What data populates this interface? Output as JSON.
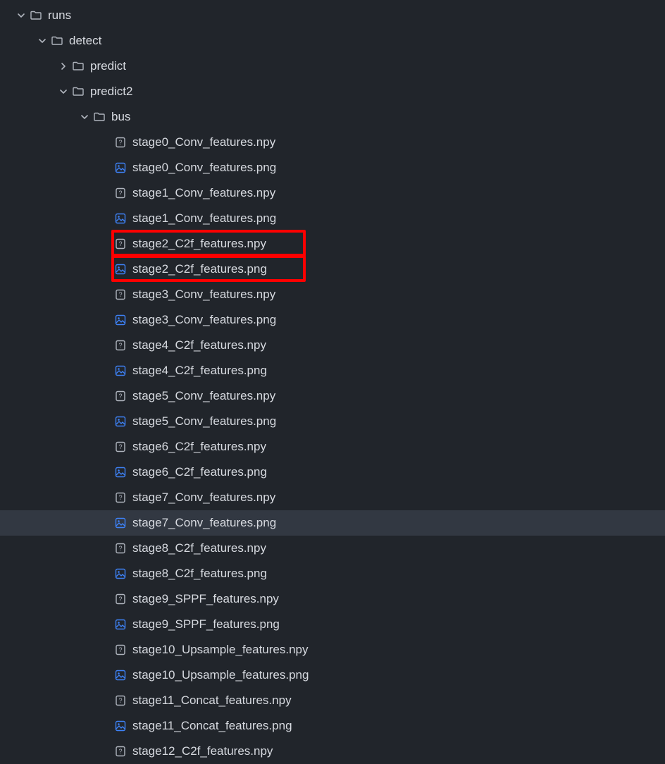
{
  "tree": [
    {
      "indent": 0,
      "type": "folder",
      "expanded": true,
      "label": "runs"
    },
    {
      "indent": 1,
      "type": "folder",
      "expanded": true,
      "label": "detect"
    },
    {
      "indent": 2,
      "type": "folder",
      "expanded": false,
      "label": "predict"
    },
    {
      "indent": 2,
      "type": "folder",
      "expanded": true,
      "label": "predict2"
    },
    {
      "indent": 3,
      "type": "folder",
      "expanded": true,
      "label": "bus"
    },
    {
      "indent": 4,
      "type": "npy",
      "label": "stage0_Conv_features.npy"
    },
    {
      "indent": 4,
      "type": "png",
      "label": "stage0_Conv_features.png"
    },
    {
      "indent": 4,
      "type": "npy",
      "label": "stage1_Conv_features.npy"
    },
    {
      "indent": 4,
      "type": "png",
      "label": "stage1_Conv_features.png"
    },
    {
      "indent": 4,
      "type": "npy",
      "label": "stage2_C2f_features.npy",
      "highlighted": true
    },
    {
      "indent": 4,
      "type": "png",
      "label": "stage2_C2f_features.png",
      "highlighted": true
    },
    {
      "indent": 4,
      "type": "npy",
      "label": "stage3_Conv_features.npy"
    },
    {
      "indent": 4,
      "type": "png",
      "label": "stage3_Conv_features.png"
    },
    {
      "indent": 4,
      "type": "npy",
      "label": "stage4_C2f_features.npy"
    },
    {
      "indent": 4,
      "type": "png",
      "label": "stage4_C2f_features.png"
    },
    {
      "indent": 4,
      "type": "npy",
      "label": "stage5_Conv_features.npy"
    },
    {
      "indent": 4,
      "type": "png",
      "label": "stage5_Conv_features.png"
    },
    {
      "indent": 4,
      "type": "npy",
      "label": "stage6_C2f_features.npy"
    },
    {
      "indent": 4,
      "type": "png",
      "label": "stage6_C2f_features.png"
    },
    {
      "indent": 4,
      "type": "npy",
      "label": "stage7_Conv_features.npy"
    },
    {
      "indent": 4,
      "type": "png",
      "label": "stage7_Conv_features.png",
      "selected": true
    },
    {
      "indent": 4,
      "type": "npy",
      "label": "stage8_C2f_features.npy"
    },
    {
      "indent": 4,
      "type": "png",
      "label": "stage8_C2f_features.png"
    },
    {
      "indent": 4,
      "type": "npy",
      "label": "stage9_SPPF_features.npy"
    },
    {
      "indent": 4,
      "type": "png",
      "label": "stage9_SPPF_features.png"
    },
    {
      "indent": 4,
      "type": "npy",
      "label": "stage10_Upsample_features.npy"
    },
    {
      "indent": 4,
      "type": "png",
      "label": "stage10_Upsample_features.png"
    },
    {
      "indent": 4,
      "type": "npy",
      "label": "stage11_Concat_features.npy"
    },
    {
      "indent": 4,
      "type": "png",
      "label": "stage11_Concat_features.png"
    },
    {
      "indent": 4,
      "type": "npy",
      "label": "stage12_C2f_features.npy"
    }
  ],
  "icons": {
    "folder_color": "#b0b5be",
    "npy_color": "#b0b5be",
    "png_color": "#3e82f7"
  }
}
